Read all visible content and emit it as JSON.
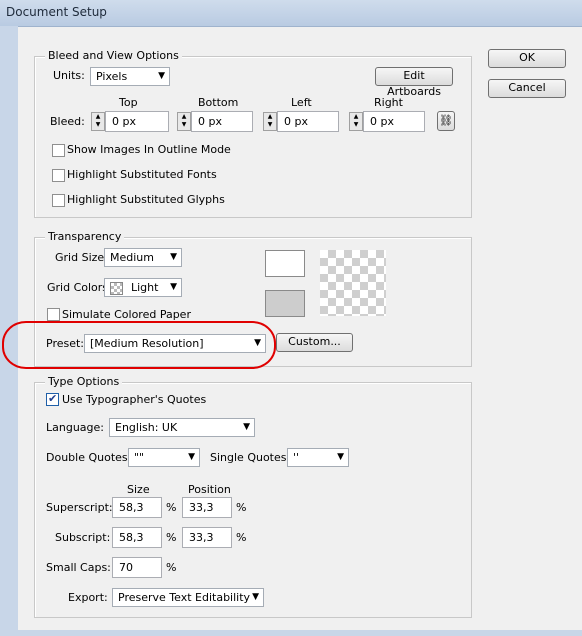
{
  "window": {
    "title": "Document Setup"
  },
  "buttons": {
    "ok": "OK",
    "cancel": "Cancel"
  },
  "bleed": {
    "legend": "Bleed and View Options",
    "units_label": "Units:",
    "units_value": "Pixels",
    "edit_artboards": "Edit Artboards",
    "bleed_label": "Bleed:",
    "fields": [
      {
        "label": "Top",
        "value": "0 px"
      },
      {
        "label": "Bottom",
        "value": "0 px"
      },
      {
        "label": "Left",
        "value": "0 px"
      },
      {
        "label": "Right",
        "value": "0 px"
      }
    ],
    "checkboxes": [
      {
        "label": "Show Images In Outline Mode",
        "checked": false
      },
      {
        "label": "Highlight Substituted Fonts",
        "checked": false
      },
      {
        "label": "Highlight Substituted Glyphs",
        "checked": false
      }
    ]
  },
  "transparency": {
    "legend": "Transparency",
    "grid_size_label": "Grid Size:",
    "grid_size_value": "Medium",
    "grid_colors_label": "Grid Colors:",
    "grid_colors_value": "Light",
    "simulate_label": "Simulate Colored Paper",
    "simulate_checked": false,
    "preset_label": "Preset:",
    "preset_value": "[Medium Resolution]",
    "custom_button": "Custom..."
  },
  "type_options": {
    "legend": "Type Options",
    "typographers_quotes_label": "Use Typographer's Quotes",
    "typographers_quotes_checked": true,
    "language_label": "Language:",
    "language_value": "English: UK",
    "double_quotes_label": "Double Quotes:",
    "double_quotes_value": "\"\"",
    "single_quotes_label": "Single Quotes:",
    "single_quotes_value": "''",
    "size_header": "Size",
    "position_header": "Position",
    "superscript_label": "Superscript:",
    "superscript_size": "58,3",
    "superscript_position": "33,3",
    "subscript_label": "Subscript:",
    "subscript_size": "58,3",
    "subscript_position": "33,3",
    "small_caps_label": "Small Caps:",
    "small_caps_value": "70",
    "percent": "%",
    "export_label": "Export:",
    "export_value": "Preserve Text Editability"
  }
}
